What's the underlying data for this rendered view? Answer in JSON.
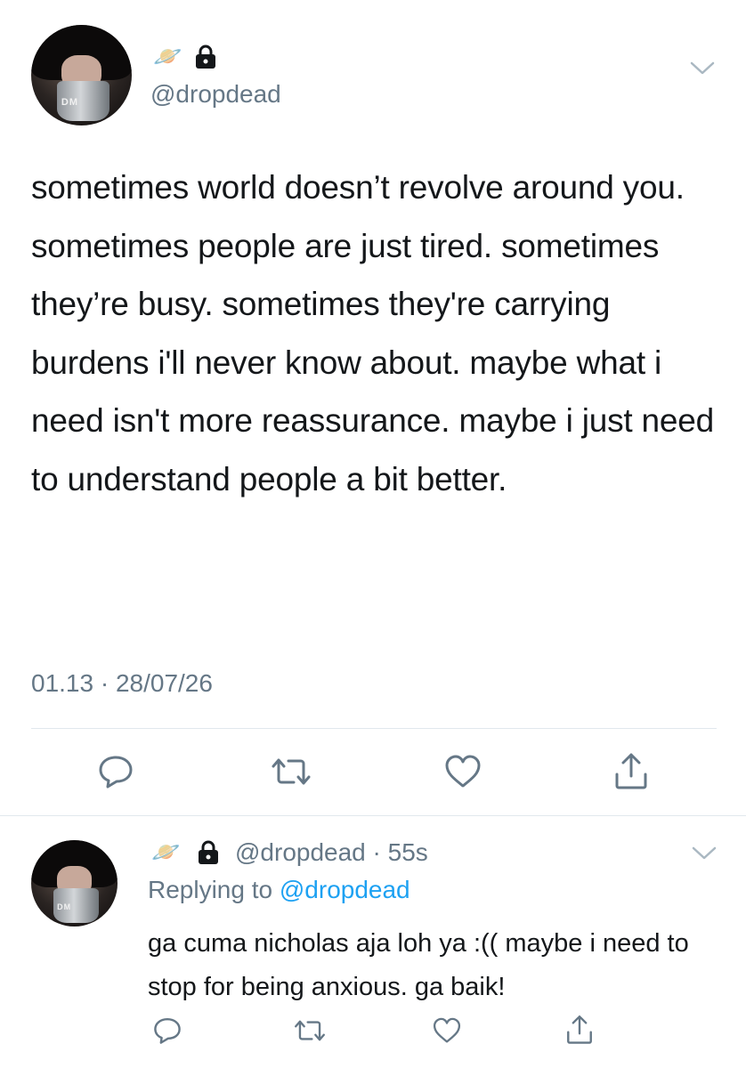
{
  "main_tweet": {
    "name_emoji": "🪐",
    "handle": "@dropdead",
    "avatar_text": "DM",
    "text": "sometimes world doesn’t revolve around you. sometimes people are just tired. sometimes they’re busy. sometimes they're carrying burdens i'll never know about. maybe what i need isn't more reassurance. maybe i just need to understand people a bit better.",
    "timestamp": "01.13 · 28/07/26"
  },
  "reply_tweet": {
    "name_emoji": "🪐",
    "handle": "@dropdead",
    "separator": "·",
    "time_ago": "55s",
    "avatar_text": "DM",
    "replying_prefix": "Replying to",
    "replying_to": "@dropdead",
    "text": "ga cuma nicholas aja loh ya :(( maybe i need to stop for being anxious. ga baik!"
  },
  "icons": {
    "reply": "reply-icon",
    "retweet": "retweet-icon",
    "like": "heart-icon",
    "share": "share-icon",
    "more": "chevron-down-icon",
    "lock": "lock-icon"
  },
  "colors": {
    "text": "#14171a",
    "secondary": "#657786",
    "link": "#1da1f2",
    "divider": "#e1e8ed"
  }
}
